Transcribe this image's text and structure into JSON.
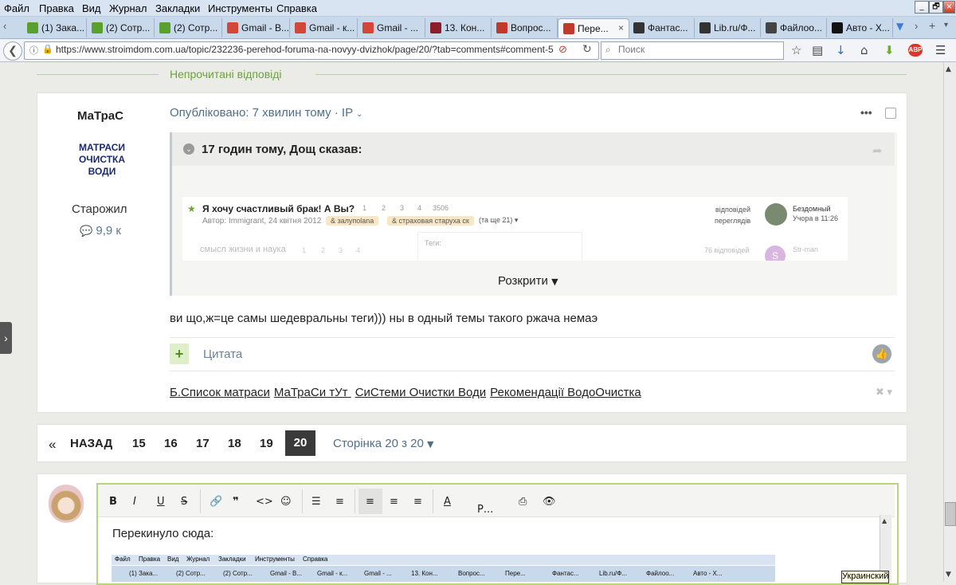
{
  "menu": [
    "Файл",
    "Правка",
    "Вид",
    "Журнал",
    "Закладки",
    "Инструменты",
    "Справка"
  ],
  "window_buttons": [
    "_",
    "🗗",
    "×"
  ],
  "tabs": [
    {
      "title": "(1) Зака...",
      "icon": "green-folder-icon",
      "color": "#5aa02c"
    },
    {
      "title": "(2) Сотр...",
      "icon": "green-folder-icon",
      "color": "#5aa02c"
    },
    {
      "title": "(2) Сотр...",
      "icon": "green-folder-icon",
      "color": "#5aa02c"
    },
    {
      "title": "Gmail - В...",
      "icon": "gmail-icon",
      "color": "#d44638"
    },
    {
      "title": "Gmail - к...",
      "icon": "gmail-icon",
      "color": "#d44638"
    },
    {
      "title": "Gmail - ...",
      "icon": "gmail-icon",
      "color": "#d44638"
    },
    {
      "title": "13. Кон...",
      "icon": "pen-icon",
      "color": "#8a1e2a"
    },
    {
      "title": "Вопрос...",
      "icon": "home-icon",
      "color": "#c0392b"
    },
    {
      "title": "Пере...",
      "icon": "home-icon",
      "color": "#c0392b",
      "active": true
    },
    {
      "title": "Фантас...",
      "icon": "building-icon",
      "color": "#333"
    },
    {
      "title": "Lib.ru/Ф...",
      "icon": "building-icon",
      "color": "#333"
    },
    {
      "title": "Файлоо...",
      "icon": "file-icon",
      "color": "#444"
    },
    {
      "title": "Авто - Х...",
      "icon": "car-icon",
      "color": "#111"
    }
  ],
  "nav": {
    "url": "https://www.stroimdom.com.ua/topic/232236-perehod-foruma-na-novyy-dvizhok/page/20/?tab=comments#comment-5019725",
    "search_placeholder": "Поиск"
  },
  "unread_label": "Непрочитані відповіді",
  "post": {
    "author": "МаТраС",
    "author_logo": [
      "МАТРАСИ",
      "ОЧИСТКА",
      "ВОДИ"
    ],
    "rank": "Старожил",
    "reputation": "9,9 к",
    "meta": "Опубліковано: 7 хвилин тому · IP",
    "quote_title": "17 годин тому, Дощ сказав:",
    "embedded": {
      "topic1": "Я хочу счастливый брак! А Вы?",
      "topic1_pages": [
        "1",
        "2",
        "3",
        "4",
        "3506"
      ],
      "topic1_author": "Автор: Immigrant, 24 квітня 2012",
      "tags": [
        "& залупolana",
        "& страховая старуха ск"
      ],
      "more_tags": "(та ще 21) ▾",
      "replies_label": "відповідей",
      "views_label": "переглядів",
      "last_user1": "Бездомный",
      "last_time1": "Учора в 11:26",
      "topic2": "смысл жизни и наука",
      "topic2_pages": [
        "1",
        "2",
        "3",
        "4"
      ],
      "tags_popup": "Теги:",
      "replies2": "76 відповідей",
      "last_user2": "Str-man"
    },
    "expand_label": "Розкрити",
    "body": "ви що,ж=це самы шедевральны теги))) ны в одный темы такого ржача немаэ",
    "quote_button": "Цитата",
    "signature": [
      "Б.Список матраси",
      "МаТраСи тУт ",
      "СиСтеми Очистки Води",
      "Рекомендації ВодоОчистка"
    ]
  },
  "pagination": {
    "prev": "«",
    "back": "НАЗАД",
    "pages": [
      "15",
      "16",
      "17",
      "18",
      "19"
    ],
    "current": "20",
    "of": "Сторінка 20 з 20"
  },
  "editor": {
    "text": "Перекинуло сюда:",
    "para_label": "Р..."
  },
  "embedded_menu": [
    "Файл",
    "Правка",
    "Вид",
    "Журнал",
    "Закладки",
    "Инструменты",
    "Справка"
  ],
  "embedded_tabs": [
    "(1) Зака...",
    "(2) Сотр...",
    "(2) Сотр...",
    "Gmail - В...",
    "Gmail - к...",
    "Gmail - ...",
    "13. Кон...",
    "Вопрос...",
    "Пере...",
    "Фантас...",
    "Lib.ru/Ф...",
    "Файлоо...",
    "Авто - Х..."
  ],
  "language_tooltip": "Украинский"
}
